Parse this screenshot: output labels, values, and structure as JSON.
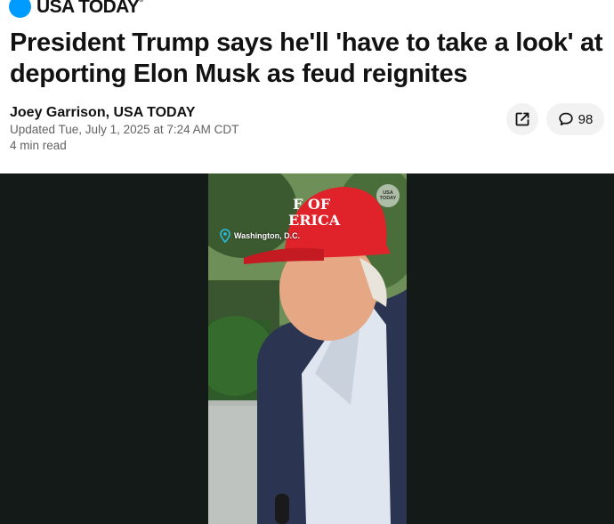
{
  "masthead": {
    "logo_text": "USA TODAY",
    "logo_mark": "®",
    "logo_color": "#009bff"
  },
  "article": {
    "headline": "President Trump says he'll 'have to take a look' at deporting Elon Musk as feud reignites",
    "author": "Joey Garrison, USA TODAY",
    "updated": "Updated Tue, July 1, 2025 at 7:24 AM CDT",
    "read_time": "4 min read"
  },
  "actions": {
    "share_icon": "share-external-icon",
    "comment_icon": "speech-bubble-icon",
    "comment_count": "98"
  },
  "video": {
    "location": "Washington, D.C.",
    "location_icon": "map-pin-icon",
    "watermark_text": "USA TODAY",
    "hat_text_line1": "F OF",
    "hat_text_line2": "ERICA",
    "hat_color": "#e0222a",
    "background_color": "#141a17"
  }
}
